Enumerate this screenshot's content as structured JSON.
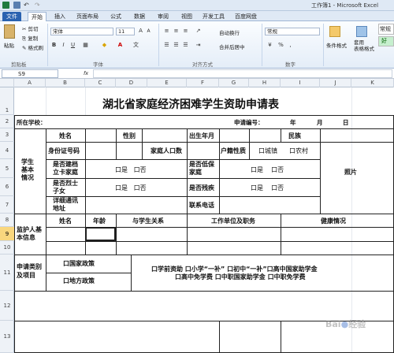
{
  "window": {
    "title": "工作簿1 - Microsoft Excel"
  },
  "tabs": [
    "文件",
    "开始",
    "插入",
    "页面布局",
    "公式",
    "数据",
    "审阅",
    "视图",
    "开发工具",
    "百度网盘"
  ],
  "ribbon": {
    "clipboard": {
      "paste": "粘贴",
      "cut": "剪切",
      "copy": "复制",
      "format_painter": "格式刷",
      "label": "剪贴板"
    },
    "font": {
      "name": "宋体",
      "size": "11",
      "label": "字体"
    },
    "alignment": {
      "wrap": "自动换行",
      "merge": "合并后居中",
      "label": "对齐方式"
    },
    "number": {
      "format": "常规",
      "percent": "%",
      "comma": ",",
      "label": "数字"
    },
    "styles": {
      "conditional": "条件格式",
      "table": "套用\n表格格式",
      "normal": "常规",
      "good": "好"
    }
  },
  "formula_bar": {
    "name_box": "S9",
    "fx": "fx"
  },
  "columns": [
    "A",
    "B",
    "C",
    "D",
    "E",
    "F",
    "G",
    "H",
    "I",
    "J",
    "K"
  ],
  "rows": [
    "1",
    "2",
    "3",
    "4",
    "5",
    "6",
    "7",
    "8",
    "9",
    "10",
    "11",
    "12",
    "13"
  ],
  "form": {
    "title": "湖北省家庭经济困难学生资助申请表",
    "school": "所在学校：",
    "app_no": "申请编号：",
    "year": "年",
    "month": "月",
    "day": "日",
    "student_info": "学生\n基本\n情况",
    "name": "姓名",
    "gender": "性别",
    "birth": "出生年月",
    "ethnicity": "民族",
    "id_no": "身份证号码",
    "family_size": "家庭人口数",
    "hukou": "户籍性质",
    "urban": "口城镇",
    "rural": "口农村",
    "archived": "是否建档\n立卡家庭",
    "yes_no_1": "口是   口否",
    "low_income": "是否低保\n家庭",
    "yes_no_2": "口是    口否",
    "photo": "照片",
    "martyr": "是否烈士\n子女",
    "yes_no_3": "口是   口否",
    "disabled": "是否残疾",
    "yes_no_4": "口是    口否",
    "address": "详细通讯\n地址",
    "phone": "联系电话",
    "guardian_info": "监护人基\n本信息",
    "g_name": "姓名",
    "g_age": "年龄",
    "g_relation": "与学生关系",
    "g_work": "工作单位及职务",
    "g_health": "健康情况",
    "apply_type": "申请类别\n及项目",
    "national": "口国家政策",
    "local": "口地方政策",
    "national_items": "口学前资助  口小学“一补”  口初中“一补”口高中国家助学金",
    "national_items2": "口高中免学费  口中职国家助学金  口中职免学费"
  }
}
